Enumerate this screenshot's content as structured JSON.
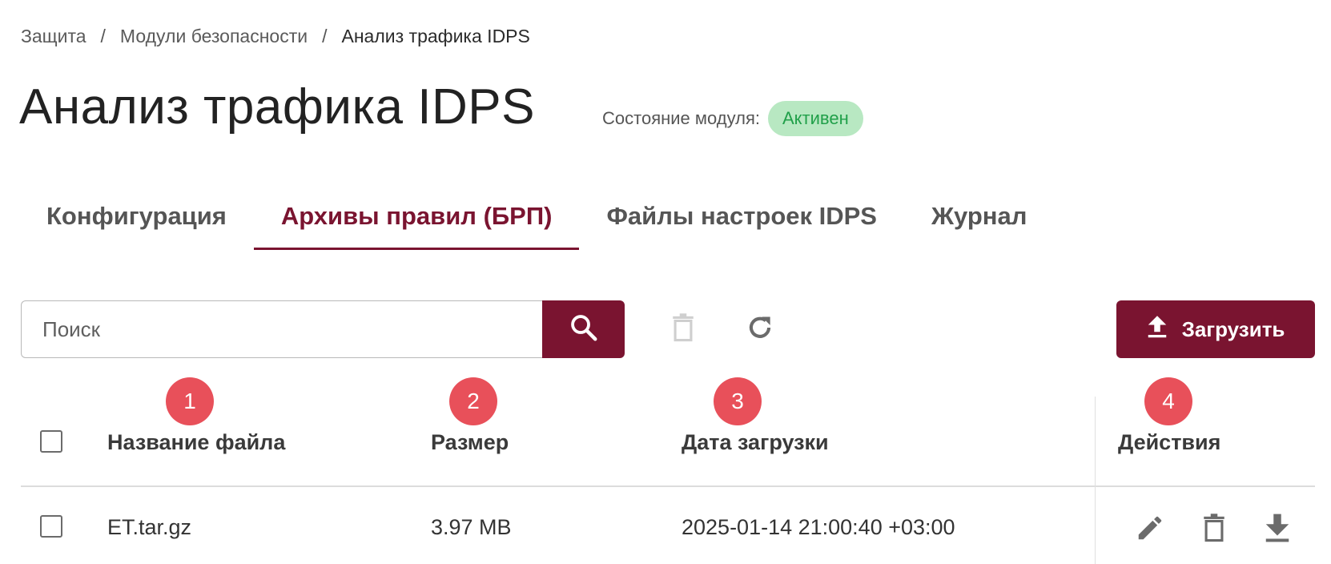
{
  "breadcrumb": {
    "items": [
      "Защита",
      "Модули безопасности",
      "Анализ трафика IDPS"
    ],
    "separator": "/"
  },
  "page": {
    "title": "Анализ трафика IDPS",
    "status_label": "Состояние модуля:",
    "status_value": "Активен"
  },
  "tabs": [
    {
      "label": "Конфигурация",
      "active": false
    },
    {
      "label": "Архивы правил (БРП)",
      "active": true
    },
    {
      "label": "Файлы настроек IDPS",
      "active": false
    },
    {
      "label": "Журнал",
      "active": false
    }
  ],
  "toolbar": {
    "search_placeholder": "Поиск",
    "search_value": "",
    "search_icon": "search-icon",
    "delete_icon": "trash-icon",
    "refresh_icon": "refresh-icon",
    "upload_label": "Загрузить",
    "upload_icon": "upload-icon"
  },
  "markers": [
    "1",
    "2",
    "3",
    "4"
  ],
  "table": {
    "columns": [
      "Название файла",
      "Размер",
      "Дата загрузки",
      "Действия"
    ],
    "rows": [
      {
        "name": "ET.tar.gz",
        "size": "3.97 MB",
        "date": "2025-01-14 21:00:40 +03:00",
        "actions": [
          "edit-icon",
          "trash-icon",
          "download-icon"
        ]
      }
    ]
  },
  "colors": {
    "accent": "#7a1430",
    "status_bg": "#b8e8c2",
    "status_text": "#21a04a",
    "marker": "#e8505a"
  }
}
